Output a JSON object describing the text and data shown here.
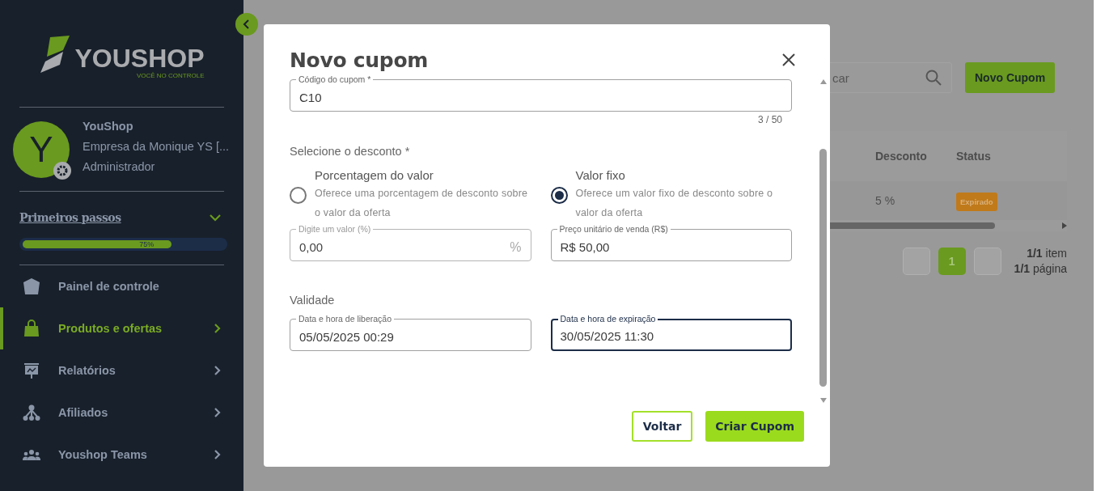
{
  "sidebar": {
    "logo": {
      "name": "YOUSHOP",
      "tagline": "VOCÊ NO CONTROLE"
    },
    "profile": {
      "initial": "Y",
      "name": "YouShop",
      "company": "Empresa da Monique YS [...",
      "role": "Administrador"
    },
    "onboarding": {
      "title": "Primeiros passos",
      "level": 0.74,
      "reading": "75%"
    },
    "nav": [
      {
        "label": "Painel de controle",
        "selected": false,
        "submenu": false
      },
      {
        "label": "Produtos e ofertas",
        "selected": true,
        "submenu": true
      },
      {
        "label": "Relatórios",
        "selected": false,
        "submenu": true
      },
      {
        "label": "Afiliados",
        "selected": false,
        "submenu": true
      },
      {
        "label": "Youshop Teams",
        "selected": false,
        "submenu": true
      }
    ]
  },
  "page": {
    "search": {
      "placeholder": "car"
    },
    "new_button": "Novo Cupom",
    "table": {
      "columns": [
        "Desconto",
        "Status"
      ],
      "rows": [
        {
          "cells": [
            "5 %"
          ],
          "status": "Expirado"
        }
      ]
    },
    "pagination": {
      "pages": [
        {
          "label": "1",
          "selected": true
        }
      ],
      "items": "**1/1** item",
      "pages_info": "**1/1** página"
    }
  },
  "dialog": {
    "title": "Novo cupom",
    "code_field": {
      "label": "Código do cupom *",
      "value": "C10",
      "counter": "3 / 50"
    },
    "discount_heading": "Selecione o desconto *",
    "discount_options": [
      {
        "title": "Porcentagem do valor",
        "description": "Oferece uma porcentagem de desconto sobre o valor da oferta",
        "selected": false
      },
      {
        "title": "Valor fixo",
        "description": "Oferece um valor fixo de desconto sobre o valor da oferta",
        "selected": true
      }
    ],
    "amount_fields": [
      {
        "label": "Digite um valor (%)",
        "value": "0,00",
        "suffix": "%",
        "disabled": true
      },
      {
        "label": "Preço unitário de venda (R$)",
        "value": "R$ 50,00",
        "disabled": false
      }
    ],
    "validity_heading": "Validade",
    "date_fields": [
      {
        "label": "Data e hora de liberação",
        "value": "05/05/2025 00:29",
        "focused": false
      },
      {
        "label": "Data e hora de expiração",
        "value": "30/05/2025 11:30",
        "focused": true
      }
    ],
    "buttons": [
      {
        "label": "Voltar",
        "kind": "outline"
      },
      {
        "label": "Criar Cupom",
        "kind": "primary"
      }
    ]
  }
}
